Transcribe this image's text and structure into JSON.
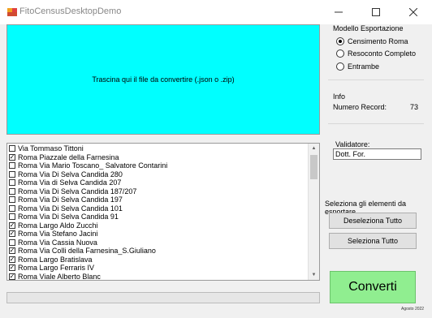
{
  "window": {
    "title": "FitoCensusDesktopDemo"
  },
  "dropzone": {
    "text": "Trascina qui il file da convertire (.json o .zip)"
  },
  "list": {
    "items": [
      {
        "label": "Via Tommaso Tittoni",
        "checked": false
      },
      {
        "label": "Roma Piazzale della Farnesina",
        "checked": true
      },
      {
        "label": "Roma Via Mario Toscano_ Salvatore Contarini",
        "checked": false
      },
      {
        "label": "Roma Via Di Selva Candida 280",
        "checked": false
      },
      {
        "label": "Roma Via di Selva Candida 207",
        "checked": false
      },
      {
        "label": "Roma Via Di Selva Candida 187/207",
        "checked": false
      },
      {
        "label": "Roma Via Di Selva Candida 197",
        "checked": false
      },
      {
        "label": "Roma Via Di Selva Candida 101",
        "checked": false
      },
      {
        "label": "Roma Via Di Selva Candida 91",
        "checked": false
      },
      {
        "label": "Roma Largo Aldo Zucchi",
        "checked": true
      },
      {
        "label": "Roma Via Stefano Jacini",
        "checked": true
      },
      {
        "label": "Roma Via Cassia Nuova",
        "checked": false
      },
      {
        "label": "Roma Via Colli della Farnesina_S.Giuliano",
        "checked": true
      },
      {
        "label": "Roma Largo Bratislava",
        "checked": true
      },
      {
        "label": "Roma Largo Ferraris IV",
        "checked": true
      },
      {
        "label": "Roma Viale Alberto Blanc",
        "checked": true
      }
    ]
  },
  "export_model": {
    "title": "Modello Esportazione",
    "options": [
      {
        "label": "Censimento Roma",
        "selected": true
      },
      {
        "label": "Resoconto Completo",
        "selected": false
      },
      {
        "label": "Entrambe",
        "selected": false
      }
    ]
  },
  "info": {
    "title": "Info",
    "record_label": "Numero Record:",
    "record_value": "73"
  },
  "validator": {
    "label": "Validatore:",
    "value": "Dott. For."
  },
  "selection": {
    "title": "Seleziona gli elementi da esportare",
    "deselect_all": "Deseleziona Tutto",
    "select_all": "Seleziona Tutto"
  },
  "convert": {
    "label": "Converti"
  },
  "footer": {
    "date": "Agosto 2022"
  },
  "colors": {
    "dropzone": "#00ffff",
    "convert_button": "#90ee90"
  },
  "icons": {
    "minimize": "minimize-icon",
    "maximize": "maximize-icon",
    "close": "close-icon"
  }
}
